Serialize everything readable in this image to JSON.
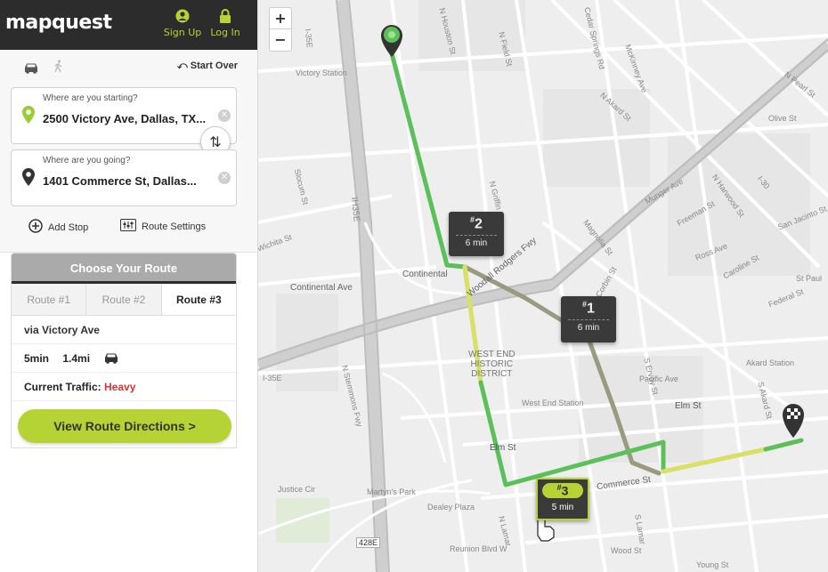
{
  "header": {
    "logo": "mapquest",
    "signup_label": "Sign Up",
    "login_label": "Log In",
    "accent_color": "#b5d334"
  },
  "modes": {
    "drive_icon": "car-icon",
    "walk_icon": "walk-icon",
    "start_over_label": "Start Over"
  },
  "route_inputs": {
    "start_label": "Where are you starting?",
    "start_value": "2500 Victory Ave, Dallas, TX...",
    "end_label": "Where are you going?",
    "end_value": "1401 Commerce St, Dallas...",
    "add_stop_label": "Add Stop",
    "route_settings_label": "Route Settings"
  },
  "choose_route": {
    "title": "Choose Your Route",
    "tabs": [
      "Route #1",
      "Route #2",
      "Route #3"
    ],
    "active_tab": "Route #3",
    "via": "via Victory Ave",
    "time": "5min",
    "distance": "1.4mi",
    "traffic_label": "Current Traffic:",
    "traffic_value": "Heavy",
    "traffic_color": "#e03030",
    "directions_button": "View Route Directions >"
  },
  "map": {
    "zoom_in": "+",
    "zoom_out": "−",
    "route_bubbles": [
      {
        "num": "2",
        "time": "6 min"
      },
      {
        "num": "1",
        "time": "6 min"
      },
      {
        "num": "3",
        "time": "5 min"
      }
    ],
    "district_label": [
      "WEST END",
      "HISTORIC",
      "DISTRICT"
    ],
    "street_labels": {
      "continental": "Continental Ave",
      "continental2": "Continental",
      "victory_station": "Victory Station",
      "i35e": "I-35E",
      "i35e2": "IH35E",
      "houston": "N Houston St",
      "field": "N Field St",
      "cedar": "Cedar Springs Rd",
      "mckinney": "McKinney Ave",
      "akard": "N Akard St",
      "olive": "Olive St",
      "pearl": "N Pearl St",
      "griffin": "N Griffin St",
      "woodall": "Woodall Rodgers Fwy",
      "magnolia": "Magnolia St",
      "corbin": "Corbin St",
      "stemmons": "N Stemmons Fwy",
      "west_end_station": "West End Station",
      "elm": "Elm St",
      "elm2": "Elm St",
      "pacific": "Pacific Ave",
      "akard_station": "Akard Station",
      "justice": "Justice Cir",
      "reunion": "Reunion Blvd W",
      "wood": "Wood St",
      "young": "Young St",
      "ross": "Ross Ave",
      "federal": "Federal St",
      "san_jacinto": "San Jacinto St",
      "st_paul": "St Paul",
      "sl_lamar": "S Lamar",
      "marilla": "Martyn's Park",
      "i30": "I-30",
      "slocum": "Slocum St",
      "wichita": "Wichita St",
      "munger": "Munger Ave",
      "freeman": "Freeman St",
      "harwood": "N Harwood St",
      "caroline": "Caroline St",
      "s_akard": "S Akard St",
      "commerce": "Commerce St",
      "ervay": "S Ervay St",
      "i35e3": "I-35E",
      "a1": "428E",
      "n_lamar": "N Lamar",
      "dealey": "Dealey Plaza"
    }
  }
}
